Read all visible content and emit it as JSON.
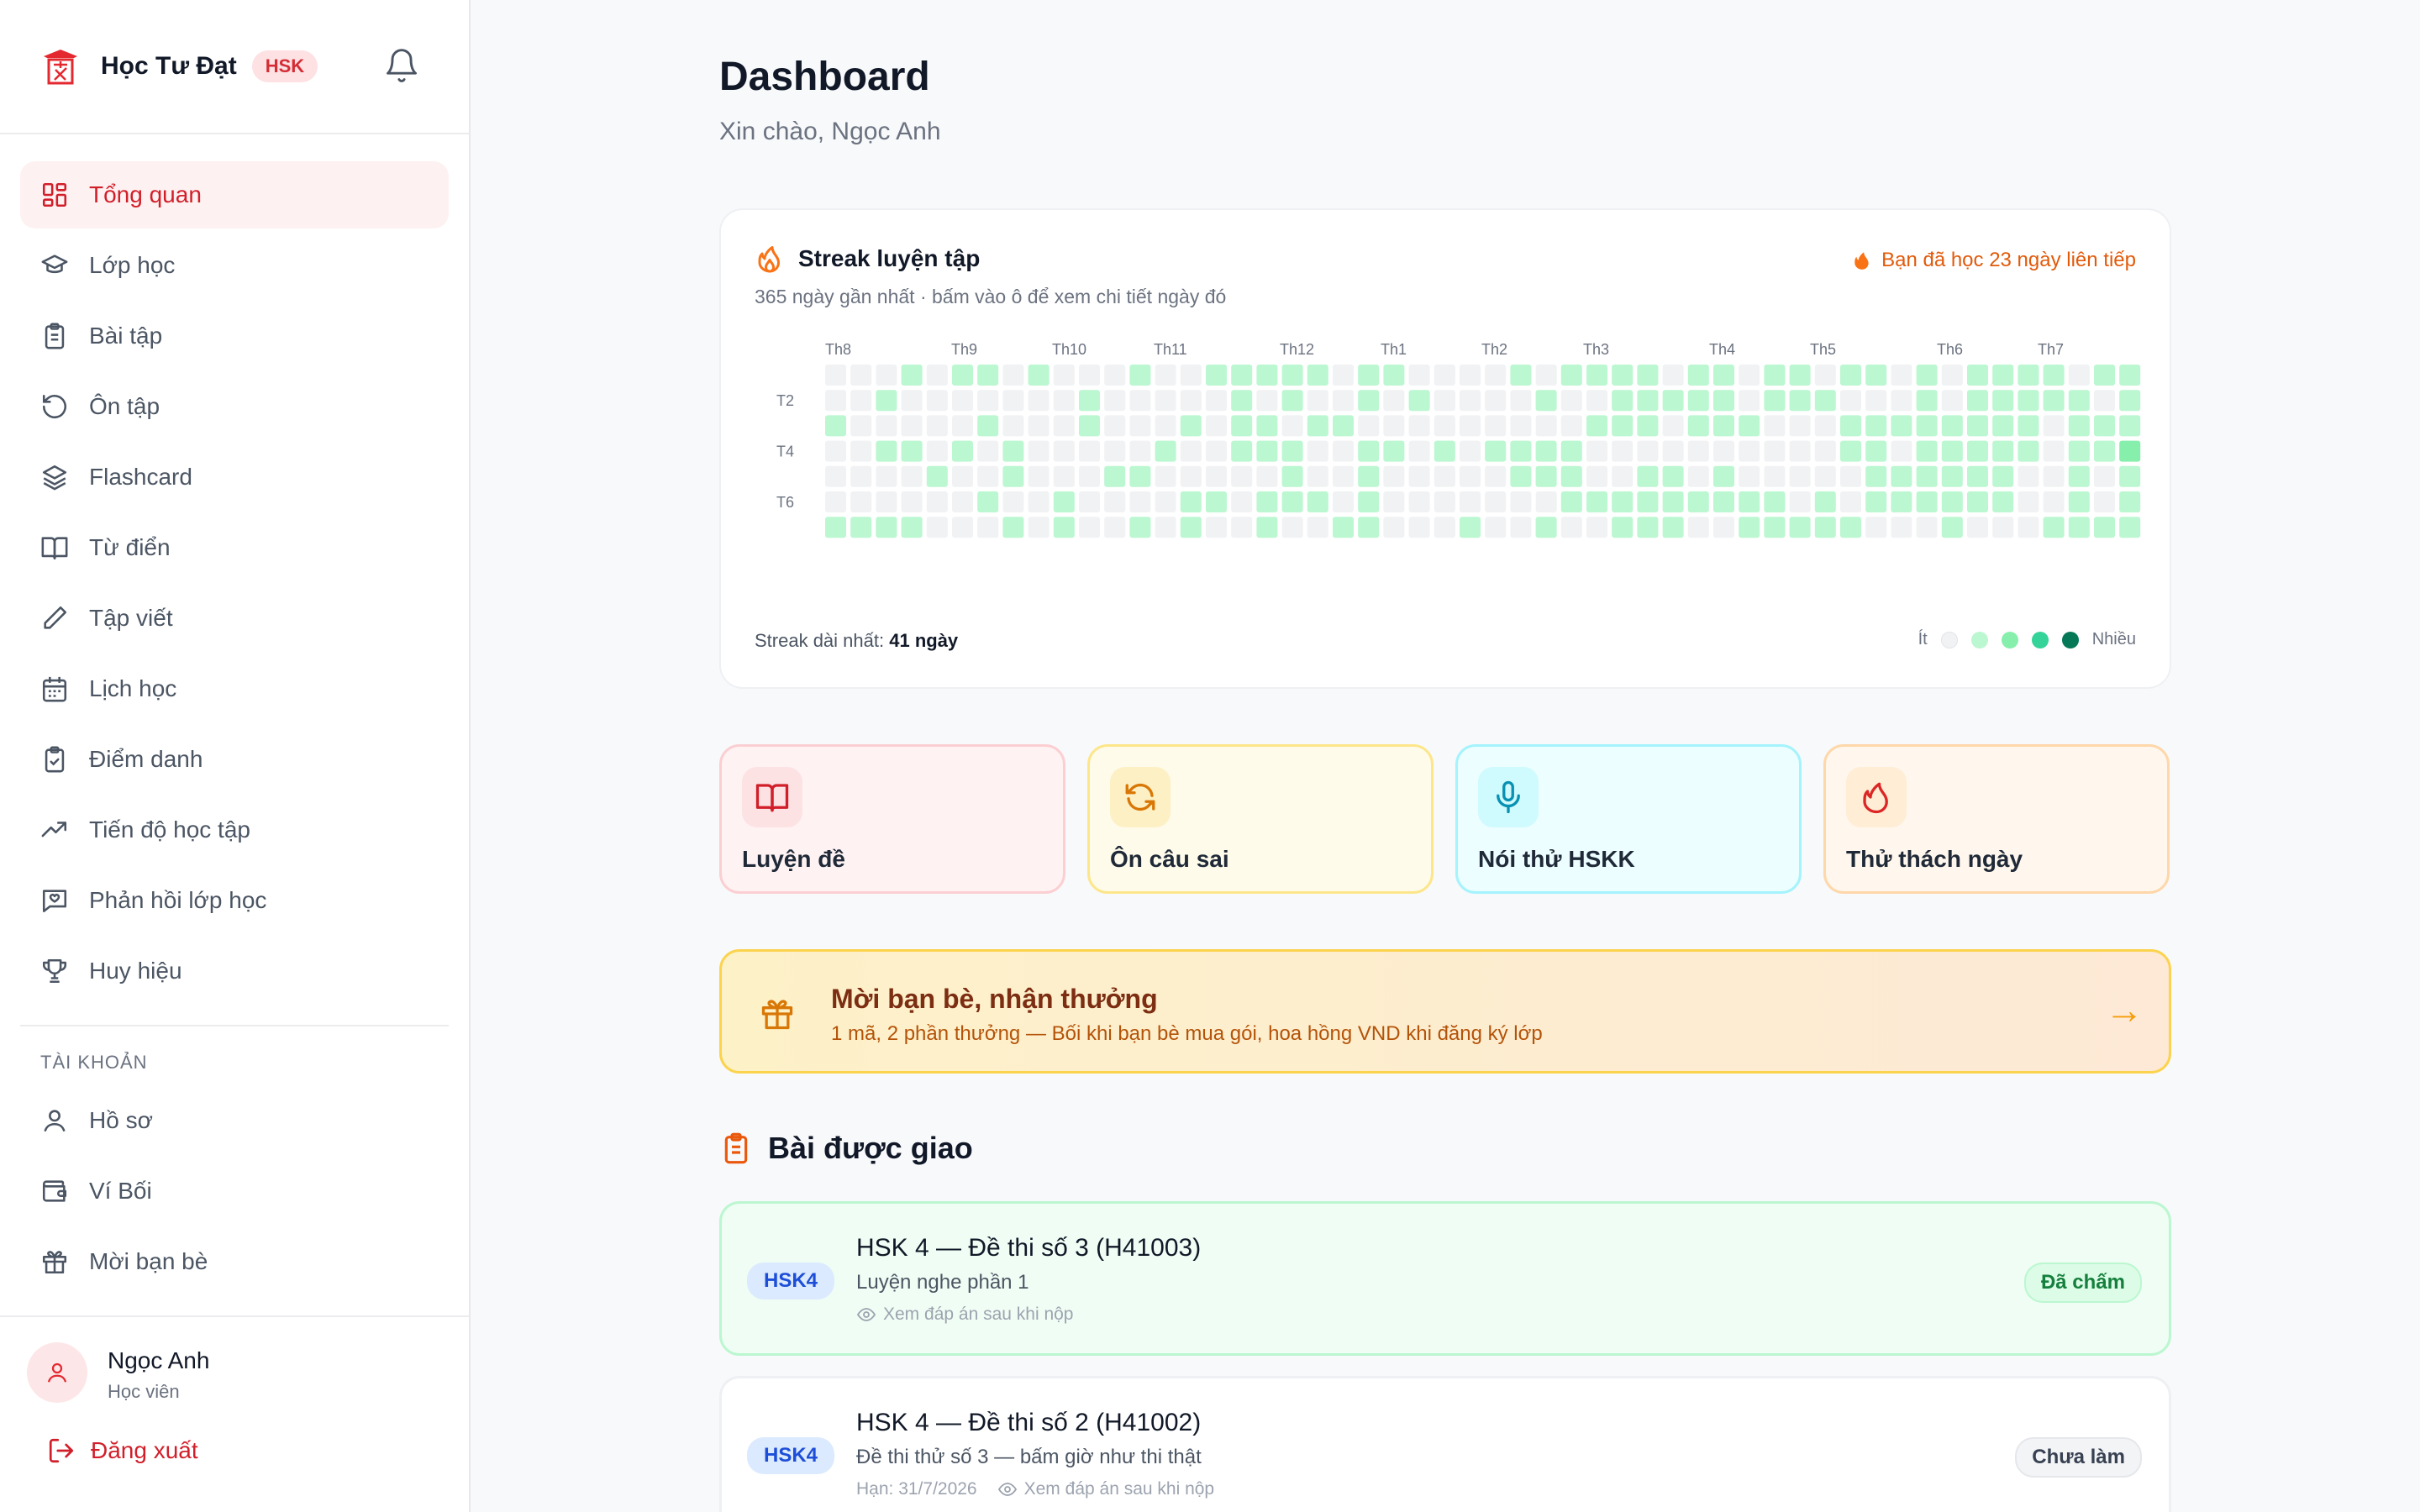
{
  "brand": {
    "name": "Học Tư Đạt",
    "badge": "HSK"
  },
  "nav": [
    {
      "label": "Tổng quan",
      "icon": "grid-icon",
      "active": true
    },
    {
      "label": "Lớp học",
      "icon": "graduation-cap-icon"
    },
    {
      "label": "Bài tập",
      "icon": "clipboard-icon"
    },
    {
      "label": "Ôn tập",
      "icon": "rotate-icon"
    },
    {
      "label": "Flashcard",
      "icon": "layers-icon"
    },
    {
      "label": "Từ điển",
      "icon": "book-icon"
    },
    {
      "label": "Tập viết",
      "icon": "pen-icon"
    },
    {
      "label": "Lịch học",
      "icon": "calendar-icon"
    },
    {
      "label": "Điểm danh",
      "icon": "clipboard-check-icon"
    },
    {
      "label": "Tiến độ học tập",
      "icon": "trend-icon"
    },
    {
      "label": "Phản hồi lớp học",
      "icon": "message-icon"
    },
    {
      "label": "Huy hiệu",
      "icon": "trophy-icon"
    }
  ],
  "account": {
    "section_label": "TÀI KHOẢN",
    "items": [
      {
        "label": "Hồ sơ",
        "icon": "user-icon"
      },
      {
        "label": "Ví Bối",
        "icon": "wallet-icon"
      },
      {
        "label": "Mời bạn bè",
        "icon": "gift-icon"
      }
    ]
  },
  "user": {
    "name": "Ngọc Anh",
    "role": "Học viên",
    "logout": "Đăng xuất"
  },
  "header": {
    "title": "Dashboard",
    "greeting": "Xin chào, Ngọc Anh"
  },
  "streak": {
    "title": "Streak luyện tập",
    "subtitle": "365 ngày gần nhất · bấm vào ô để xem chi tiết ngày đó",
    "badge": "Bạn đã học 23 ngày liên tiếp",
    "longest_label": "Streak dài nhất:",
    "longest_value": "41 ngày",
    "legend_low": "Ít",
    "legend_high": "Nhiều",
    "months": [
      "Th8",
      "Th9",
      "Th10",
      "Th11",
      "Th12",
      "Th1",
      "Th2",
      "Th3",
      "Th4",
      "Th5",
      "Th6",
      "Th7"
    ],
    "days": [
      "T2",
      "T4",
      "T6"
    ],
    "colors": [
      "#f1f2f4",
      "#bbf7d0",
      "#86efac",
      "#34d399",
      "#047857"
    ]
  },
  "tiles": [
    {
      "label": "Luyện đề",
      "icon": "open-book-icon"
    },
    {
      "label": "Ôn câu sai",
      "icon": "refresh-icon"
    },
    {
      "label": "Nói thử HSKK",
      "icon": "microphone-icon"
    },
    {
      "label": "Thử thách ngày",
      "icon": "flame-icon"
    }
  ],
  "invite": {
    "title": "Mời bạn bè, nhận thưởng",
    "subtitle": "1 mã, 2 phần thưởng — Bối khi bạn bè mua gói, hoa hồng VND khi đăng ký lớp",
    "arrow": "→"
  },
  "assignments": {
    "title": "Bài được giao",
    "items": [
      {
        "tag": "HSK4",
        "title": "HSK 4 — Đề thi số 3 (H41003)",
        "subtitle": "Luyện nghe phần 1",
        "deadline": "",
        "note": "Xem đáp án sau khi nộp",
        "status": "Đã chấm"
      },
      {
        "tag": "HSK4",
        "title": "HSK 4 — Đề thi số 2 (H41002)",
        "subtitle": "Đề thi thử số 3 — bấm giờ như thi thật",
        "deadline": "Hạn: 31/7/2026",
        "note": "Xem đáp án sau khi nộp",
        "status": "Chưa làm"
      }
    ]
  }
}
